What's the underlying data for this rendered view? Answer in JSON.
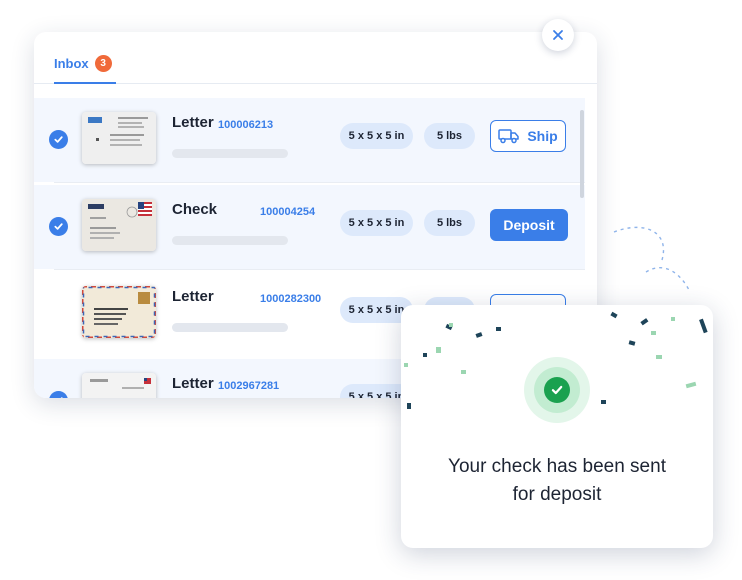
{
  "tab": {
    "label": "Inbox",
    "badge": "3"
  },
  "items": [
    {
      "title": "Letter",
      "number": "100006213",
      "size": "5 x 5 x 5 in",
      "weight": "5 lbs",
      "action": "Ship",
      "selected": true
    },
    {
      "title": "Check",
      "number": "100004254",
      "size": "5 x 5 x 5 in",
      "weight": "5 lbs",
      "action": "Deposit",
      "selected": true
    },
    {
      "title": "Letter",
      "number": "1000282300",
      "size": "5 x 5 x 5 in",
      "weight": "",
      "action": "",
      "selected": false
    },
    {
      "title": "Letter",
      "number": "1002967281",
      "size": "5 x 5 x 5 in",
      "weight": "",
      "action": "",
      "selected": true
    }
  ],
  "toast": {
    "message_line1": "Your check has been sent",
    "message_line2": "for deposit"
  },
  "colors": {
    "accent": "#3a7ee8",
    "badge": "#f06a3a",
    "success": "#1aa14f",
    "pill": "#dde9fb"
  },
  "icons": {
    "close": "close-icon",
    "check": "check-icon",
    "truck": "truck-icon",
    "success": "success-check-icon"
  }
}
